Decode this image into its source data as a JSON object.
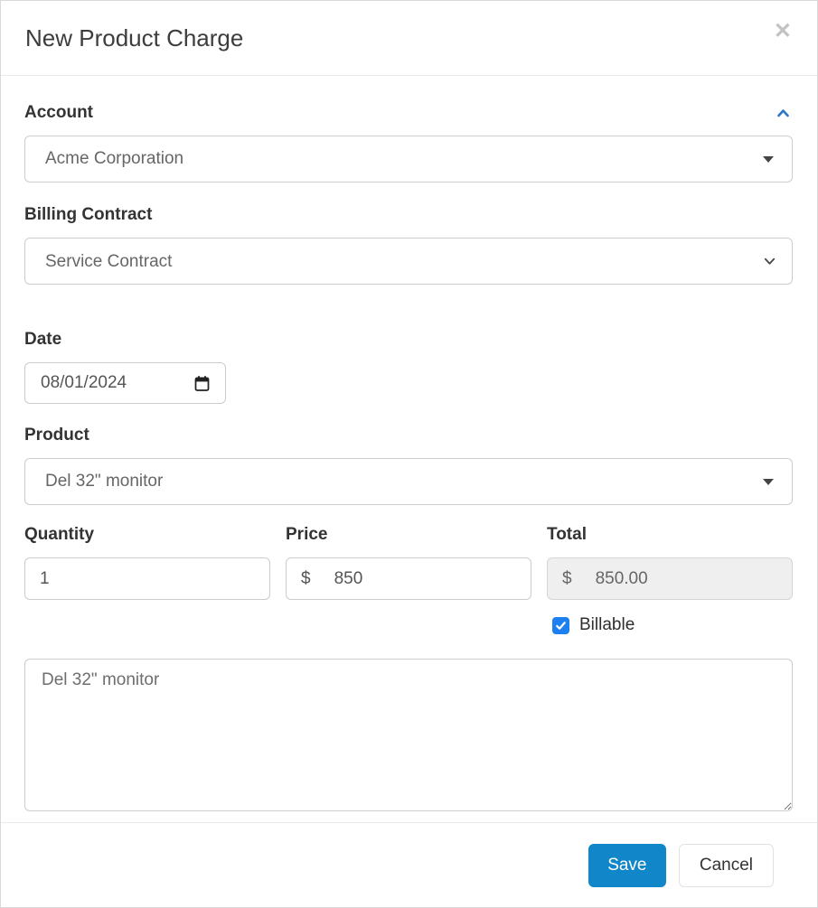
{
  "modal": {
    "title": "New Product Charge"
  },
  "icons": {
    "close": "close-icon",
    "collapse": "chevron-up-icon",
    "dropdown_caret": "caret-down-icon",
    "select_chevron": "chevron-down-icon",
    "calendar": "calendar-icon",
    "checkmark": "check-icon"
  },
  "form": {
    "account": {
      "label": "Account",
      "value": "Acme Corporation"
    },
    "billing_contract": {
      "label": "Billing Contract",
      "value": "Service Contract"
    },
    "date": {
      "label": "Date",
      "value": "08/01/2024"
    },
    "product": {
      "label": "Product",
      "value": "Del 32\" monitor"
    },
    "quantity": {
      "label": "Quantity",
      "value": "1"
    },
    "price": {
      "label": "Price",
      "currency": "$",
      "value": "850"
    },
    "total": {
      "label": "Total",
      "currency": "$",
      "value": "850.00"
    },
    "billable": {
      "label": "Billable",
      "checked": true
    },
    "description": {
      "value": "Del 32\" monitor"
    }
  },
  "footer": {
    "save_label": "Save",
    "cancel_label": "Cancel"
  },
  "colors": {
    "primary_blue": "#1187c9",
    "checkbox_blue": "#1e80f0",
    "chevron_blue": "#2e77c5",
    "border_gray": "#cccccc",
    "label_text": "#333333",
    "value_text": "#555555",
    "readonly_bg": "#efefef"
  }
}
